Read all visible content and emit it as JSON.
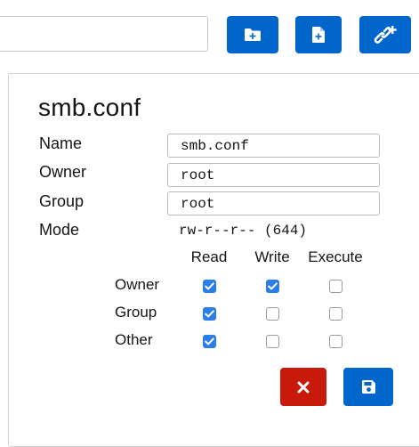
{
  "toolbar": {
    "path_value": "",
    "buttons": [
      {
        "icon": "folder-plus-icon",
        "name": "new-folder-button"
      },
      {
        "icon": "file-plus-icon",
        "name": "new-file-button"
      },
      {
        "icon": "link-plus-icon",
        "name": "new-link-button"
      }
    ],
    "accent": "#0066cc"
  },
  "properties": {
    "title": "smb.conf",
    "name_label": "Name",
    "name_value": "smb.conf",
    "owner_label": "Owner",
    "owner_value": "root",
    "group_label": "Group",
    "group_value": "root",
    "mode_label": "Mode",
    "mode_value": "rw-r--r-- (644)"
  },
  "permissions": {
    "columns": [
      "Read",
      "Write",
      "Execute"
    ],
    "rows": [
      {
        "label": "Owner",
        "read": true,
        "write": true,
        "execute": false
      },
      {
        "label": "Group",
        "read": true,
        "write": false,
        "execute": false
      },
      {
        "label": "Other",
        "read": true,
        "write": false,
        "execute": false
      }
    ],
    "checked_color": "#2b7de9"
  },
  "actions": {
    "cancel_icon": "close-icon",
    "cancel_color": "#c9190b",
    "save_icon": "save-icon",
    "save_color": "#0066cc"
  }
}
